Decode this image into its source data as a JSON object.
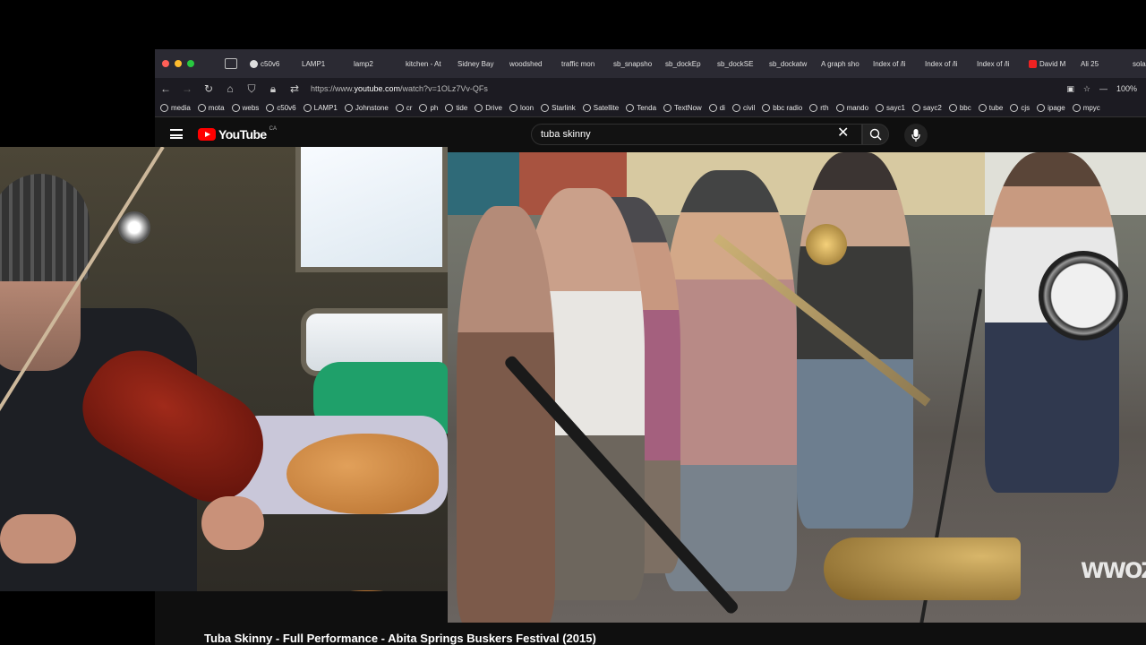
{
  "browser": {
    "tabs": [
      {
        "label": "c50v6",
        "icon": "globe"
      },
      {
        "label": "LAMP1",
        "icon": "none"
      },
      {
        "label": "lamp2",
        "icon": "none"
      },
      {
        "label": "kitchen - At",
        "icon": "none"
      },
      {
        "label": "Sidney Bay",
        "icon": "none"
      },
      {
        "label": "woodshed",
        "icon": "none"
      },
      {
        "label": "traffic mon",
        "icon": "none"
      },
      {
        "label": "sb_snapsho",
        "icon": "none"
      },
      {
        "label": "sb_dockEp",
        "icon": "none"
      },
      {
        "label": "sb_dockSE",
        "icon": "none"
      },
      {
        "label": "sb_dockatw",
        "icon": "none"
      },
      {
        "label": "A graph sho",
        "icon": "none"
      },
      {
        "label": "Index of /li",
        "icon": "none"
      },
      {
        "label": "Index of /li",
        "icon": "none"
      },
      {
        "label": "Index of /li",
        "icon": "none"
      },
      {
        "label": "David M",
        "icon": "youtube"
      },
      {
        "label": "Ali 25",
        "icon": "none"
      },
      {
        "label": "solar",
        "icon": "none"
      }
    ],
    "url_prefix": "https://www.",
    "url_domain": "youtube.com",
    "url_path": "/watch?v=1OLz7Vv-QFs",
    "zoom": "100%",
    "bookmarks": [
      "media",
      "mota",
      "webs",
      "c50v6",
      "LAMP1",
      "Johnstone",
      "cr",
      "ph",
      "tide",
      "Drive",
      "loon",
      "Starlink",
      "Satellite",
      "Tenda",
      "TextNow",
      "di",
      "civil",
      "bbc radio",
      "rth",
      "mando",
      "sayc1",
      "sayc2",
      "bbc",
      "tube",
      "cjs",
      "ipage",
      "mpyc"
    ]
  },
  "youtube": {
    "logo_text": "YouTube",
    "country_code": "CA",
    "search_value": "tuba skinny"
  },
  "video": {
    "watermark": "WWOZ",
    "title": "Tuba Skinny - Full Performance - Abita Springs Buskers Festival (2015)"
  },
  "colors": {
    "accent": "#ff0000",
    "tabbar": "#2b2a33",
    "toolbar": "#1c1b22"
  }
}
